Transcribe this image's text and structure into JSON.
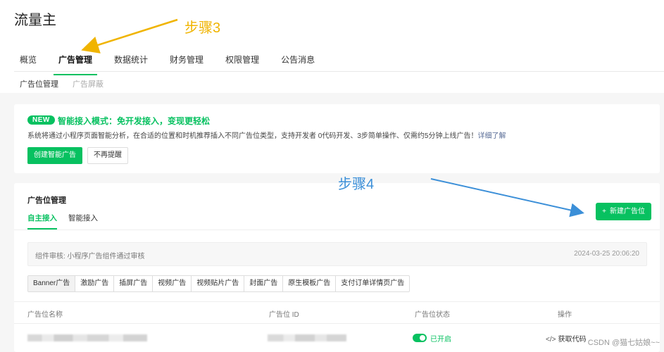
{
  "app": {
    "title": "流量主"
  },
  "main_nav": {
    "tabs": [
      {
        "label": "概览"
      },
      {
        "label": "广告管理"
      },
      {
        "label": "数据统计"
      },
      {
        "label": "财务管理"
      },
      {
        "label": "权限管理"
      },
      {
        "label": "公告消息"
      }
    ]
  },
  "sub_nav": {
    "items": [
      {
        "label": "广告位管理"
      },
      {
        "label": "广告屏蔽"
      }
    ]
  },
  "banner": {
    "badge": "NEW",
    "title": "智能接入模式：免开发接入，变现更轻松",
    "desc": "系统将通过小程序页面智能分析，在合适的位置和时机推荐插入不同广告位类型，支持开发者 0代码开发、3步简单操作、仅需约5分钟上线广告！",
    "link": "详细了解",
    "primary_btn": "创建智能广告",
    "secondary_btn": "不再提醒"
  },
  "panel": {
    "title": "广告位管理",
    "tabs": [
      {
        "label": "自主接入"
      },
      {
        "label": "智能接入"
      }
    ],
    "new_btn_icon": "+",
    "new_btn": "新建广告位",
    "notice": {
      "text": "组件审核: 小程序广告组件通过审核",
      "time": "2024-03-25 20:06:20"
    },
    "ad_types": [
      {
        "label": "Banner广告"
      },
      {
        "label": "激励广告"
      },
      {
        "label": "插屏广告"
      },
      {
        "label": "视频广告"
      },
      {
        "label": "视频贴片广告"
      },
      {
        "label": "封面广告"
      },
      {
        "label": "原生模板广告"
      },
      {
        "label": "支付订单详情页广告"
      }
    ],
    "table": {
      "headers": {
        "name": "广告位名称",
        "id": "广告位 ID",
        "status": "广告位状态",
        "action": "操作"
      },
      "row": {
        "status": "已开启",
        "action_icon": "</>",
        "action": "获取代码"
      }
    }
  },
  "annotations": {
    "step3": "步骤3",
    "step4": "步骤4"
  },
  "watermark": "CSDN @猫七姑娘~~",
  "colors": {
    "accent": "#07c160",
    "step3": "#f0b400",
    "step4": "#3b8fd8",
    "link": "#576b95"
  }
}
